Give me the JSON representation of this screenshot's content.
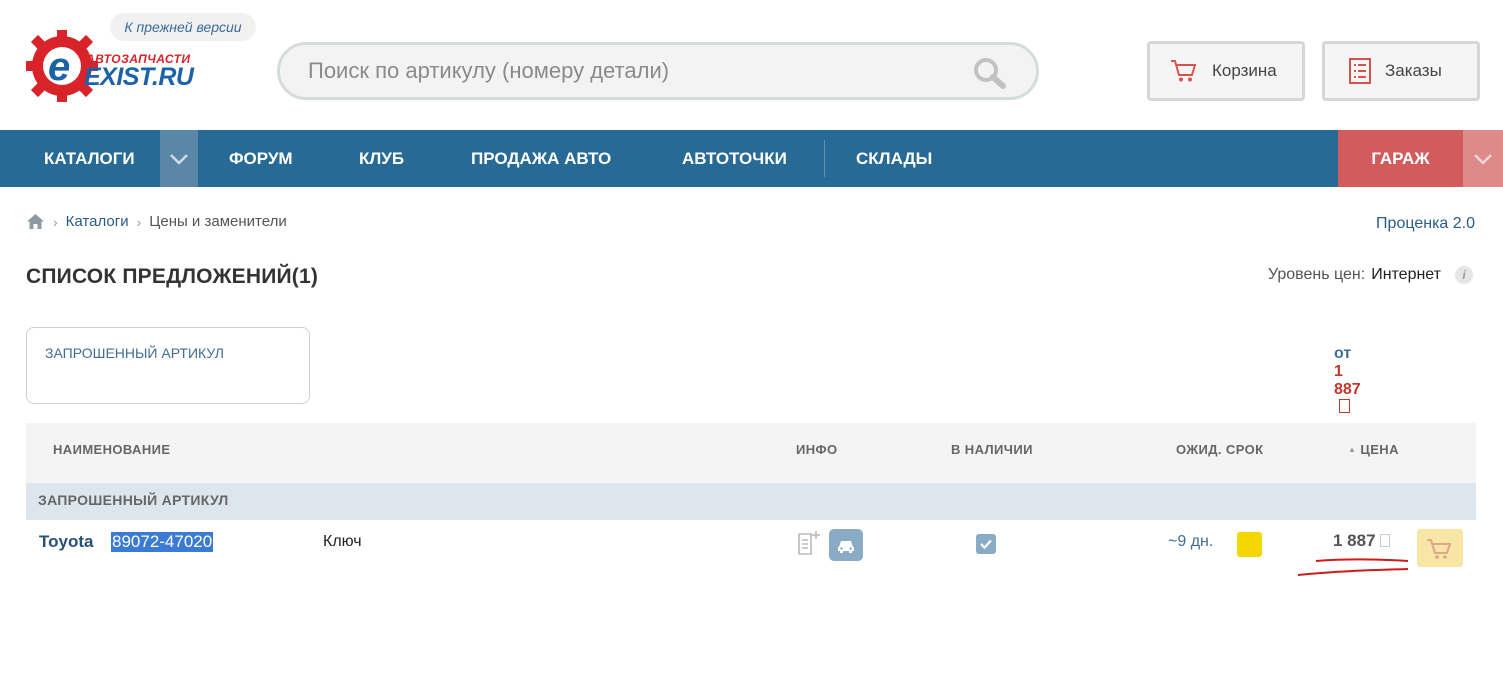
{
  "header": {
    "logo_small": "АВТОЗАПЧАСТИ",
    "logo_text": "EXIST.RU",
    "prev_version": "К прежней версии",
    "search_placeholder": "Поиск по артикулу (номеру детали)",
    "cart_label": "Корзина",
    "orders_label": "Заказы"
  },
  "nav": {
    "items": [
      "КАТАЛОГИ",
      "ФОРУМ",
      "КЛУБ",
      "ПРОДАЖА АВТО",
      "АВТОТОЧКИ",
      "СКЛАДЫ"
    ],
    "garage": "ГАРАЖ"
  },
  "breadcrumb": {
    "items": [
      "Каталоги",
      "Цены и заменители"
    ]
  },
  "procenka": "Проценка 2.0",
  "page_title": "СПИСОК ПРЕДЛОЖЕНИЙ(1)",
  "price_level": {
    "label": "Уровень цен:",
    "value": "Интернет"
  },
  "requested_card": {
    "label": "ЗАПРОШЕННЫЙ АРТИКУЛ",
    "prefix": "от",
    "price": "1 887"
  },
  "table": {
    "headers": {
      "name": "НАИМЕНОВАНИЕ",
      "info": "ИНФО",
      "stock": "В НАЛИЧИИ",
      "term": "ОЖИД. СРОК",
      "price": "ЦЕНА"
    },
    "group": "ЗАПРОШЕННЫЙ АРТИКУЛ",
    "rows": [
      {
        "brand": "Toyota",
        "article": "89072-47020",
        "description": "Ключ",
        "term": "~9 дн.",
        "price": "1 887",
        "in_stock": true
      }
    ]
  },
  "colors": {
    "nav_bg": "#276a96",
    "garage_bg": "#d25c5c",
    "accent_red": "#c0392b",
    "link_blue": "#2a5c8a",
    "term_indicator": "#f4d700"
  }
}
